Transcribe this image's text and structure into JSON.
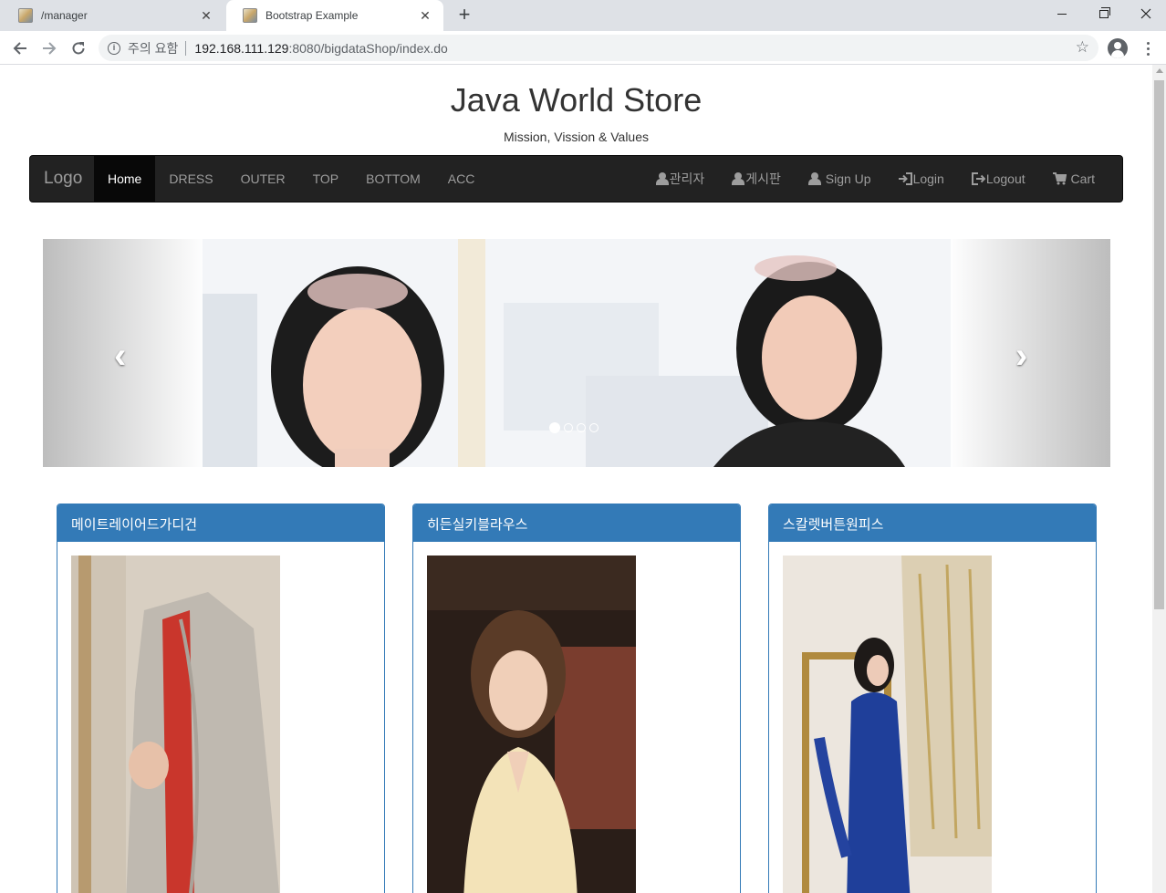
{
  "browser": {
    "tabs": [
      {
        "title": "/manager",
        "close": "✕"
      },
      {
        "title": "Bootstrap Example",
        "close": "✕"
      }
    ],
    "new_tab": "+",
    "security_label": "주의 요함",
    "url_host": "192.168.111.129",
    "url_path": ":8080/bigdataShop/index.do"
  },
  "site": {
    "title": "Java World Store",
    "subtitle": "Mission, Vission & Values"
  },
  "navbar": {
    "brand": "Logo",
    "left_items": [
      "Home",
      "DRESS",
      "OUTER",
      "TOP",
      "BOTTOM",
      "ACC"
    ],
    "active": "Home",
    "right_items": [
      {
        "label": "관리자",
        "icon": "user-icon"
      },
      {
        "label": "게시판",
        "icon": "user-icon"
      },
      {
        "label": "Sign Up",
        "icon": "user-icon"
      },
      {
        "label": "Login",
        "icon": "login-icon"
      },
      {
        "label": "Logout",
        "icon": "logout-icon"
      },
      {
        "label": "Cart",
        "icon": "cart-icon"
      }
    ]
  },
  "carousel": {
    "prev": "‹",
    "next": "›",
    "slide_count": 4,
    "active_index": 0
  },
  "products": [
    {
      "name": "메이트레이어드가디건"
    },
    {
      "name": "히든실키블라우스"
    },
    {
      "name": "스칼렛버튼원피스"
    }
  ],
  "colors": {
    "navbar_bg": "#222222",
    "panel_primary": "#337ab7"
  }
}
